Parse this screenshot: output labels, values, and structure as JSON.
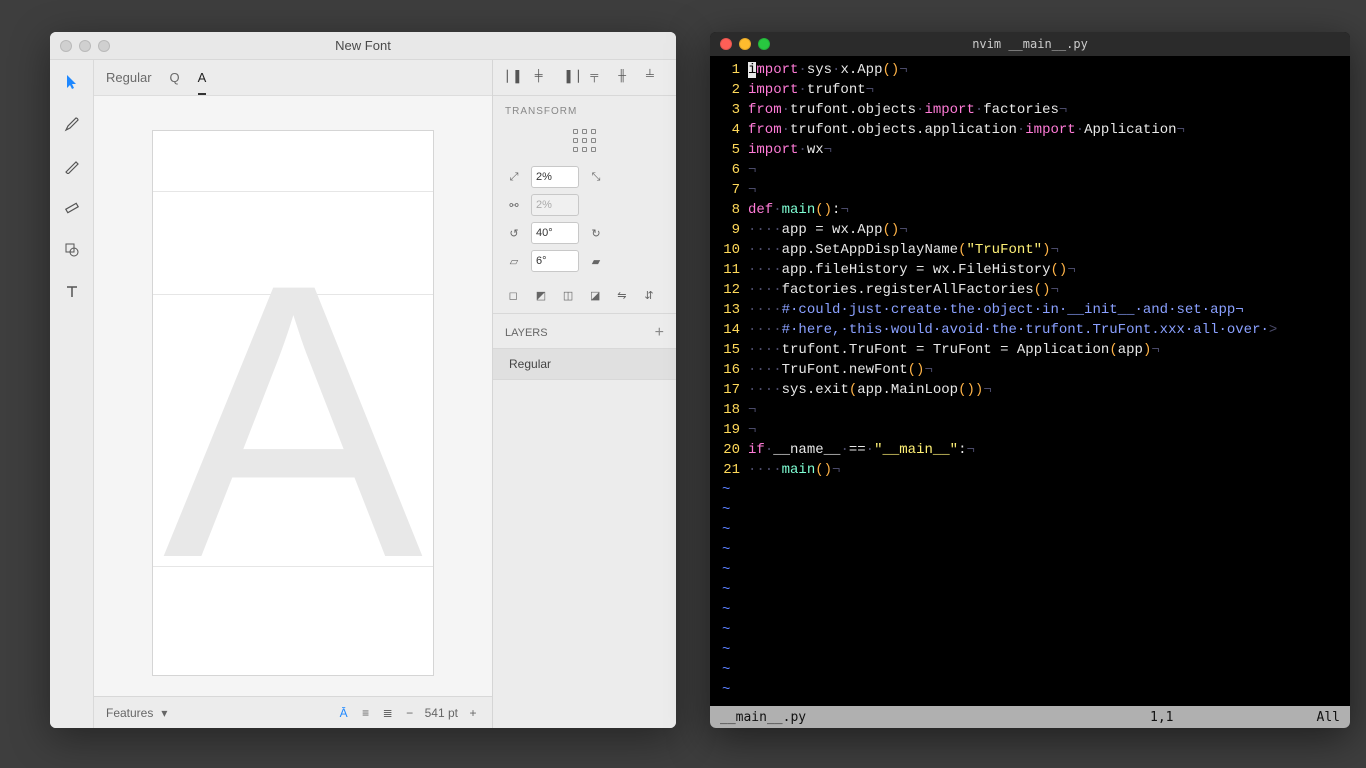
{
  "font_editor": {
    "title": "New Font",
    "tabs": {
      "style": "Regular",
      "q": "Q",
      "a": "A"
    },
    "transform": {
      "label": "TRANSFORM",
      "scale": "2%",
      "scale_linked": "2%",
      "rotate": "40°",
      "skew": "6°"
    },
    "layers": {
      "label": "LAYERS",
      "items": [
        "Regular"
      ]
    },
    "footer": {
      "features": "Features",
      "pt": "541 pt"
    }
  },
  "terminal": {
    "title": "nvim __main__.py",
    "status": {
      "file": "__main__.py",
      "pos": "1,1",
      "pct": "All"
    },
    "code": [
      {
        "n": 1,
        "seg": [
          [
            "cursor",
            "i"
          ],
          [
            "kw",
            "mport"
          ],
          [
            "sp",
            "·"
          ],
          [
            "id",
            "sys"
          ],
          [
            "sp",
            "·"
          ],
          [
            "id",
            "x"
          ],
          [
            "op",
            "."
          ],
          [
            "id",
            "App"
          ],
          [
            "pn",
            "()"
          ],
          [
            "sp",
            "¬"
          ]
        ]
      },
      {
        "n": 2,
        "seg": [
          [
            "kw",
            "import"
          ],
          [
            "sp",
            "·"
          ],
          [
            "id",
            "trufont"
          ],
          [
            "sp",
            "¬"
          ]
        ]
      },
      {
        "n": 3,
        "seg": [
          [
            "kw",
            "from"
          ],
          [
            "sp",
            "·"
          ],
          [
            "id",
            "trufont"
          ],
          [
            "op",
            "."
          ],
          [
            "id",
            "objects"
          ],
          [
            "sp",
            "·"
          ],
          [
            "kw",
            "import"
          ],
          [
            "sp",
            "·"
          ],
          [
            "id",
            "factories"
          ],
          [
            "sp",
            "¬"
          ]
        ]
      },
      {
        "n": 4,
        "seg": [
          [
            "kw",
            "from"
          ],
          [
            "sp",
            "·"
          ],
          [
            "id",
            "trufont"
          ],
          [
            "op",
            "."
          ],
          [
            "id",
            "objects"
          ],
          [
            "op",
            "."
          ],
          [
            "id",
            "application"
          ],
          [
            "sp",
            "·"
          ],
          [
            "kw",
            "import"
          ],
          [
            "sp",
            "·"
          ],
          [
            "id",
            "Application"
          ],
          [
            "sp",
            "¬"
          ]
        ]
      },
      {
        "n": 5,
        "seg": [
          [
            "kw",
            "import"
          ],
          [
            "sp",
            "·"
          ],
          [
            "id",
            "wx"
          ],
          [
            "sp",
            "¬"
          ]
        ]
      },
      {
        "n": 6,
        "seg": [
          [
            "sp",
            "¬"
          ]
        ]
      },
      {
        "n": 7,
        "seg": [
          [
            "sp",
            "¬"
          ]
        ]
      },
      {
        "n": 8,
        "seg": [
          [
            "kw",
            "def"
          ],
          [
            "sp",
            "·"
          ],
          [
            "fn",
            "main"
          ],
          [
            "pn",
            "()"
          ],
          [
            "op",
            ":"
          ],
          [
            "sp",
            "¬"
          ]
        ]
      },
      {
        "n": 9,
        "seg": [
          [
            "sp",
            "····"
          ],
          [
            "id",
            "app"
          ],
          [
            "op",
            " = "
          ],
          [
            "id",
            "wx"
          ],
          [
            "op",
            "."
          ],
          [
            "id",
            "App"
          ],
          [
            "pn",
            "()"
          ],
          [
            "sp",
            "¬"
          ]
        ]
      },
      {
        "n": 10,
        "seg": [
          [
            "sp",
            "····"
          ],
          [
            "id",
            "app"
          ],
          [
            "op",
            "."
          ],
          [
            "id",
            "SetAppDisplayName"
          ],
          [
            "pn",
            "("
          ],
          [
            "str",
            "\"TruFont\""
          ],
          [
            "pn",
            ")"
          ],
          [
            "sp",
            "¬"
          ]
        ]
      },
      {
        "n": 11,
        "seg": [
          [
            "sp",
            "····"
          ],
          [
            "id",
            "app"
          ],
          [
            "op",
            "."
          ],
          [
            "id",
            "fileHistory"
          ],
          [
            "op",
            " = "
          ],
          [
            "id",
            "wx"
          ],
          [
            "op",
            "."
          ],
          [
            "id",
            "FileHistory"
          ],
          [
            "pn",
            "()"
          ],
          [
            "sp",
            "¬"
          ]
        ]
      },
      {
        "n": 12,
        "seg": [
          [
            "sp",
            "····"
          ],
          [
            "id",
            "factories"
          ],
          [
            "op",
            "."
          ],
          [
            "id",
            "registerAllFactories"
          ],
          [
            "pn",
            "()"
          ],
          [
            "sp",
            "¬"
          ]
        ]
      },
      {
        "n": 13,
        "seg": [
          [
            "sp",
            "····"
          ],
          [
            "cm",
            "#·could·just·create·the·object·in·__init__·and·set·app¬"
          ]
        ]
      },
      {
        "n": 14,
        "seg": [
          [
            "sp",
            "····"
          ],
          [
            "cm",
            "#·here,·this·would·avoid·the·trufont.TruFont.xxx·all·over·"
          ],
          [
            "sp",
            ">"
          ]
        ]
      },
      {
        "n": 15,
        "seg": [
          [
            "sp",
            "····"
          ],
          [
            "id",
            "trufont"
          ],
          [
            "op",
            "."
          ],
          [
            "id",
            "TruFont"
          ],
          [
            "op",
            " = "
          ],
          [
            "id",
            "TruFont"
          ],
          [
            "op",
            " = "
          ],
          [
            "id",
            "Application"
          ],
          [
            "pn",
            "("
          ],
          [
            "id",
            "app"
          ],
          [
            "pn",
            ")"
          ],
          [
            "sp",
            "¬"
          ]
        ]
      },
      {
        "n": 16,
        "seg": [
          [
            "sp",
            "····"
          ],
          [
            "id",
            "TruFont"
          ],
          [
            "op",
            "."
          ],
          [
            "id",
            "newFont"
          ],
          [
            "pn",
            "()"
          ],
          [
            "sp",
            "¬"
          ]
        ]
      },
      {
        "n": 17,
        "seg": [
          [
            "sp",
            "····"
          ],
          [
            "id",
            "sys"
          ],
          [
            "op",
            "."
          ],
          [
            "id",
            "exit"
          ],
          [
            "pn",
            "("
          ],
          [
            "id",
            "app"
          ],
          [
            "op",
            "."
          ],
          [
            "id",
            "MainLoop"
          ],
          [
            "pn",
            "()"
          ],
          [
            "pn",
            ")"
          ],
          [
            "sp",
            "¬"
          ]
        ]
      },
      {
        "n": 18,
        "seg": [
          [
            "sp",
            "¬"
          ]
        ]
      },
      {
        "n": 19,
        "seg": [
          [
            "sp",
            "¬"
          ]
        ]
      },
      {
        "n": 20,
        "seg": [
          [
            "kw",
            "if"
          ],
          [
            "sp",
            "·"
          ],
          [
            "id",
            "__name__"
          ],
          [
            "sp",
            "·"
          ],
          [
            "op",
            "=="
          ],
          [
            "sp",
            "·"
          ],
          [
            "str",
            "\"__main__\""
          ],
          [
            "op",
            ":"
          ],
          [
            "sp",
            "¬"
          ]
        ]
      },
      {
        "n": 21,
        "seg": [
          [
            "sp",
            "····"
          ],
          [
            "fn",
            "main"
          ],
          [
            "pn",
            "()"
          ],
          [
            "sp",
            "¬"
          ]
        ]
      }
    ]
  }
}
